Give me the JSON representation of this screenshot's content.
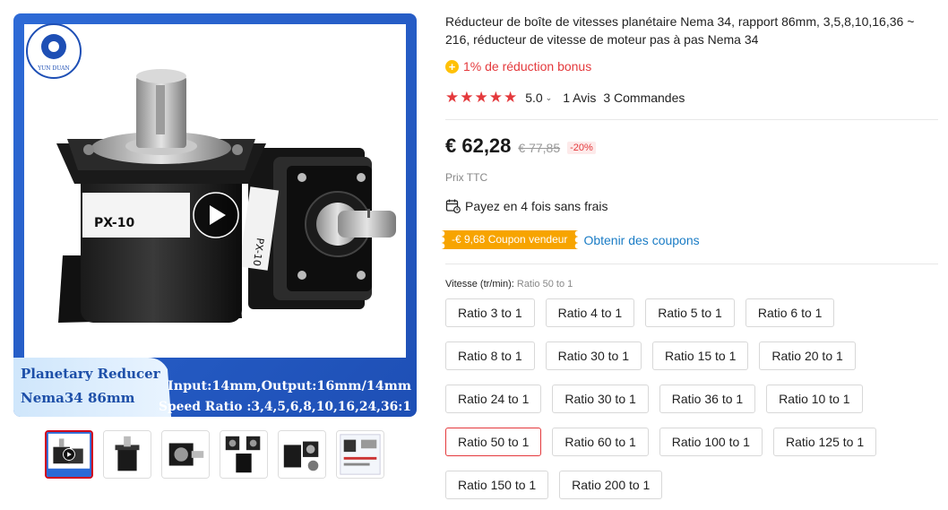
{
  "gallery": {
    "logo_text": "YUN DUAN",
    "label_front": "PX-10",
    "banner_left_line1": "Planetary Reducer",
    "banner_left_line2": "Nema34 86mm",
    "banner_right_line1": "Input:14mm,Output:16mm/14mm",
    "banner_right_line2": "Speed Ratio :3,4,5,6,8,10,16,24,36:1",
    "thumbnail_count": 6
  },
  "product": {
    "title": "Réducteur de boîte de vitesses planétaire Nema 34, rapport 86mm, 3,5,8,10,16,36 ~ 216, réducteur de vitesse de moteur pas à pas Nema 34",
    "bonus_icon": "plus-icon",
    "bonus_text": "1% de réduction bonus",
    "rating_value": "5.0",
    "stars": 5,
    "reviews": "1 Avis",
    "orders": "3 Commandes",
    "price": "€ 62,28",
    "old_price": "€ 77,85",
    "discount": "-20%",
    "tax_note": "Prix TTC",
    "installments": "Payez en 4 fois sans frais",
    "coupon_badge": "-€ 9,68 Coupon vendeur",
    "coupon_link": "Obtenir des coupons"
  },
  "variants": {
    "label": "Vitesse (tr/min): ",
    "selected": "Ratio 50 to 1",
    "rows": [
      [
        "Ratio 3 to 1",
        "Ratio 4 to 1",
        "Ratio 5 to 1",
        "Ratio 6 to 1"
      ],
      [
        "Ratio 8 to 1",
        "Ratio 30 to 1",
        "Ratio 15 to 1",
        "Ratio 20 to 1"
      ],
      [
        "Ratio 24 to 1",
        "Ratio 30 to 1",
        "Ratio 36 to 1",
        "Ratio 10 to 1"
      ],
      [
        "Ratio 50 to 1",
        "Ratio 60 to 1",
        "Ratio 100 to 1",
        "Ratio 125 to 1"
      ],
      [
        "Ratio 150 to 1",
        "Ratio 200 to 1"
      ]
    ]
  },
  "colors": {
    "accent_red": "#e4393c",
    "banner_blue": "#1f5fc9",
    "coupon_orange": "#f7a400",
    "link_blue": "#1a7cc5"
  }
}
